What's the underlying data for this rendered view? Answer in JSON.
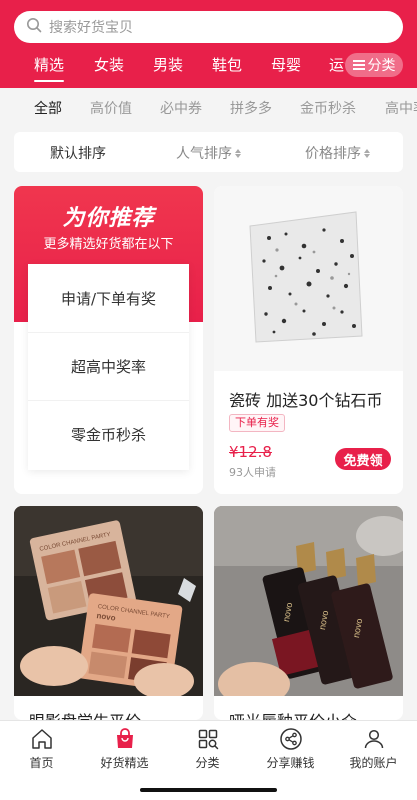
{
  "search": {
    "placeholder": "搜索好货宝贝"
  },
  "categories": [
    "精选",
    "女装",
    "男装",
    "鞋包",
    "母婴",
    "运动"
  ],
  "category_button": "分类",
  "subtabs": [
    "全部",
    "高价值",
    "必中券",
    "拼多多",
    "金币秒杀",
    "高中率"
  ],
  "sort": {
    "default": "默认排序",
    "popularity": "人气排序",
    "price": "价格排序"
  },
  "recommend": {
    "title": "为你推荐",
    "subtitle": "更多精选好货都在以下",
    "items": [
      "申请/下单有奖",
      "超高中奖率",
      "零金币秒杀"
    ]
  },
  "products": [
    {
      "title": "瓷砖 加送30个钻石币",
      "tag": "下单有奖",
      "price": "¥12.8",
      "applicants": "93人申请",
      "button": "免费领"
    },
    {
      "title": "眼影盘学生平价",
      "image_text": "COLOR CHANNEL PARTY"
    },
    {
      "title": "哑光唇釉平价小众",
      "image_text": "novo"
    }
  ],
  "bottom_nav": [
    "首页",
    "好货精选",
    "分类",
    "分享赚钱",
    "我的账户"
  ],
  "colors": {
    "brand": "#e8204a",
    "background": "#f4f4f4"
  },
  "icons": [
    "search-icon",
    "menu-icon",
    "home-icon",
    "shopping-bag-icon",
    "grid-search-icon",
    "share-icon",
    "user-icon"
  ]
}
